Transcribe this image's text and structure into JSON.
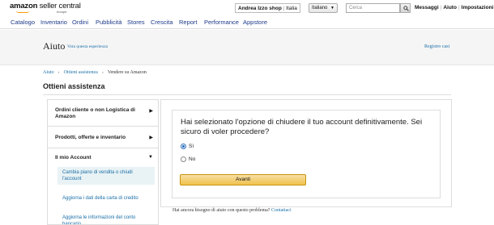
{
  "header": {
    "logo_brand": "amazon",
    "logo_product": " seller central",
    "logo_region": "europe",
    "shop_name": "Andrea Izzo shop",
    "shop_country": "Italia",
    "language": "Italiano",
    "search_placeholder": "Cerca",
    "links": [
      "Messaggi",
      "Aiuto",
      "Impostazioni"
    ]
  },
  "nav": {
    "items": [
      "Catalogo",
      "Inventario",
      "Ordini",
      "Pubblicità",
      "Stores",
      "Crescita",
      "Report",
      "Performance",
      "Appstore"
    ]
  },
  "help": {
    "title": "Aiuto",
    "subtitle": "Vota questa esperienza",
    "registro": "Registro casi"
  },
  "breadcrumb": [
    "Aiuto",
    "Ottieni assistenza",
    "Vendere su Amazon"
  ],
  "page_title": "Ottieni assistenza",
  "sidebar": {
    "items": [
      {
        "label": "Ordini cliente o non Logistica di Amazon",
        "arrow": "▶"
      },
      {
        "label": "Prodotti, offerte e inventario",
        "arrow": "▶"
      },
      {
        "label": "Il mio Account",
        "arrow": "▼"
      }
    ],
    "subitems": [
      "Cambia piano di vendita o chiudi l'account",
      "Aggiorna i dati della carta di credito",
      "Aggiorna le informazioni del conto bancario"
    ]
  },
  "main": {
    "question": "Hai selezionato l'opzione di chiudere il tuo account definitivamente. Sei sicuro di voler procedere?",
    "options": [
      "Sì",
      "No"
    ],
    "selected": "Sì",
    "button": "Avanti",
    "help_text": "Hai ancora bisogno di aiuto con questo problema?",
    "help_link": "Contattaci"
  },
  "colors": {
    "link": "#1a6fa8",
    "nav_link": "#1d3a8a",
    "button": "#f0c14b",
    "logo_accent": "#ff9900"
  }
}
